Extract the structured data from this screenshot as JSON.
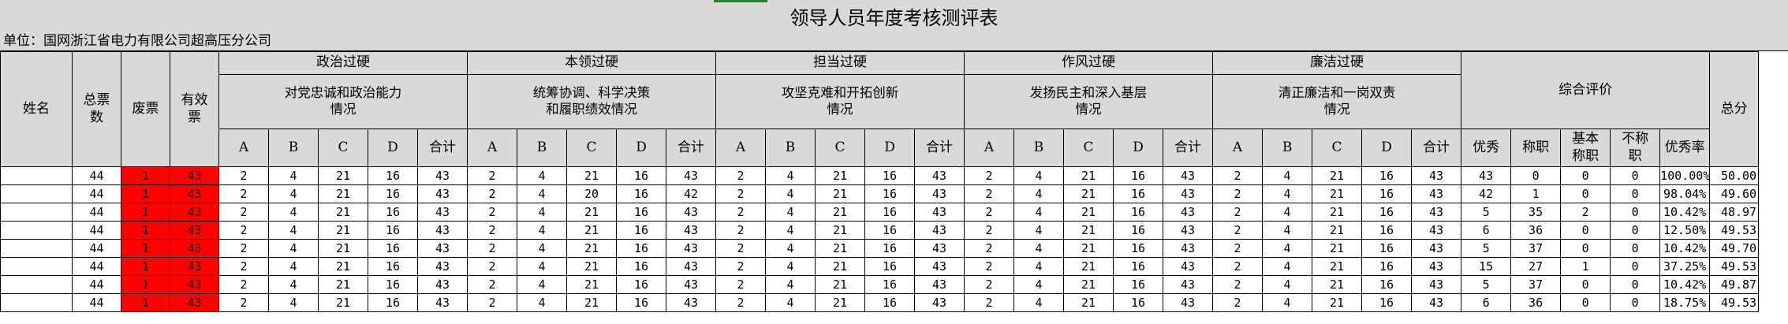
{
  "title": "领导人员年度考核测评表",
  "unit_label": "单位：国网浙江省电力有限公司超高压分公司",
  "headers": {
    "name": "姓名",
    "total_votes": "总票\n数",
    "void_votes": "废票",
    "valid_votes": "有效\n票",
    "categories": [
      {
        "title": "政治过硬",
        "sub": "对党忠诚和政治能力\n情况"
      },
      {
        "title": "本领过硬",
        "sub": "统筹协调、科学决策\n和履职绩效情况"
      },
      {
        "title": "担当过硬",
        "sub": "攻坚克难和开拓创新\n情况"
      },
      {
        "title": "作风过硬",
        "sub": "发扬民主和深入基层\n情况"
      },
      {
        "title": "廉洁过硬",
        "sub": "清正廉洁和一岗双责\n情况"
      }
    ],
    "grades": [
      "A",
      "B",
      "C",
      "D",
      "合计"
    ],
    "overall": "综合评价",
    "overall_cols": [
      "优秀",
      "称职",
      "基本\n称职",
      "不称\n职",
      "优秀率"
    ],
    "score": "总分"
  },
  "rows": [
    {
      "name": "",
      "total": "44",
      "void": "1",
      "valid": "43",
      "cats": [
        [
          "2",
          "4",
          "21",
          "16",
          "43"
        ],
        [
          "2",
          "4",
          "21",
          "16",
          "43"
        ],
        [
          "2",
          "4",
          "21",
          "16",
          "43"
        ],
        [
          "2",
          "4",
          "21",
          "16",
          "43"
        ],
        [
          "2",
          "4",
          "21",
          "16",
          "43"
        ]
      ],
      "overall": [
        "43",
        "0",
        "0",
        "0",
        "100.00%"
      ],
      "score": "50.00"
    },
    {
      "name": "",
      "total": "44",
      "void": "1",
      "valid": "43",
      "cats": [
        [
          "2",
          "4",
          "21",
          "16",
          "43"
        ],
        [
          "2",
          "4",
          "20",
          "16",
          "42"
        ],
        [
          "2",
          "4",
          "21",
          "16",
          "43"
        ],
        [
          "2",
          "4",
          "21",
          "16",
          "43"
        ],
        [
          "2",
          "4",
          "21",
          "16",
          "43"
        ]
      ],
      "overall": [
        "42",
        "1",
        "0",
        "0",
        "98.04%"
      ],
      "score": "49.60"
    },
    {
      "name": "",
      "total": "44",
      "void": "1",
      "valid": "43",
      "cats": [
        [
          "2",
          "4",
          "21",
          "16",
          "43"
        ],
        [
          "2",
          "4",
          "21",
          "16",
          "43"
        ],
        [
          "2",
          "4",
          "21",
          "16",
          "43"
        ],
        [
          "2",
          "4",
          "21",
          "16",
          "43"
        ],
        [
          "2",
          "4",
          "21",
          "16",
          "43"
        ]
      ],
      "overall": [
        "5",
        "35",
        "2",
        "0",
        "10.42%"
      ],
      "score": "48.97"
    },
    {
      "name": "",
      "total": "44",
      "void": "1",
      "valid": "43",
      "cats": [
        [
          "2",
          "4",
          "21",
          "16",
          "43"
        ],
        [
          "2",
          "4",
          "21",
          "16",
          "43"
        ],
        [
          "2",
          "4",
          "21",
          "16",
          "43"
        ],
        [
          "2",
          "4",
          "21",
          "16",
          "43"
        ],
        [
          "2",
          "4",
          "21",
          "16",
          "43"
        ]
      ],
      "overall": [
        "6",
        "36",
        "0",
        "0",
        "12.50%"
      ],
      "score": "49.53"
    },
    {
      "name": "",
      "total": "44",
      "void": "1",
      "valid": "43",
      "cats": [
        [
          "2",
          "4",
          "21",
          "16",
          "43"
        ],
        [
          "2",
          "4",
          "21",
          "16",
          "43"
        ],
        [
          "2",
          "4",
          "21",
          "16",
          "43"
        ],
        [
          "2",
          "4",
          "21",
          "16",
          "43"
        ],
        [
          "2",
          "4",
          "21",
          "16",
          "43"
        ]
      ],
      "overall": [
        "5",
        "37",
        "0",
        "0",
        "10.42%"
      ],
      "score": "49.70"
    },
    {
      "name": "",
      "total": "44",
      "void": "1",
      "valid": "43",
      "cats": [
        [
          "2",
          "4",
          "21",
          "16",
          "43"
        ],
        [
          "2",
          "4",
          "21",
          "16",
          "43"
        ],
        [
          "2",
          "4",
          "21",
          "16",
          "43"
        ],
        [
          "2",
          "4",
          "21",
          "16",
          "43"
        ],
        [
          "2",
          "4",
          "21",
          "16",
          "43"
        ]
      ],
      "overall": [
        "15",
        "27",
        "1",
        "0",
        "37.25%"
      ],
      "score": "49.53"
    },
    {
      "name": "",
      "total": "44",
      "void": "1",
      "valid": "43",
      "cats": [
        [
          "2",
          "4",
          "21",
          "16",
          "43"
        ],
        [
          "2",
          "4",
          "21",
          "16",
          "43"
        ],
        [
          "2",
          "4",
          "21",
          "16",
          "43"
        ],
        [
          "2",
          "4",
          "21",
          "16",
          "43"
        ],
        [
          "2",
          "4",
          "21",
          "16",
          "43"
        ]
      ],
      "overall": [
        "5",
        "37",
        "0",
        "0",
        "10.42%"
      ],
      "score": "49.87"
    },
    {
      "name": "",
      "total": "44",
      "void": "1",
      "valid": "43",
      "cats": [
        [
          "2",
          "4",
          "21",
          "16",
          "43"
        ],
        [
          "2",
          "4",
          "21",
          "16",
          "43"
        ],
        [
          "2",
          "4",
          "21",
          "16",
          "43"
        ],
        [
          "2",
          "4",
          "21",
          "16",
          "43"
        ],
        [
          "2",
          "4",
          "21",
          "16",
          "43"
        ]
      ],
      "overall": [
        "6",
        "36",
        "0",
        "0",
        "18.75%"
      ],
      "score": "49.53"
    }
  ],
  "colors": {
    "header_bg": "#d9d9d9",
    "void_highlight": "#ff0000",
    "title_accent": "#2e7d32"
  }
}
